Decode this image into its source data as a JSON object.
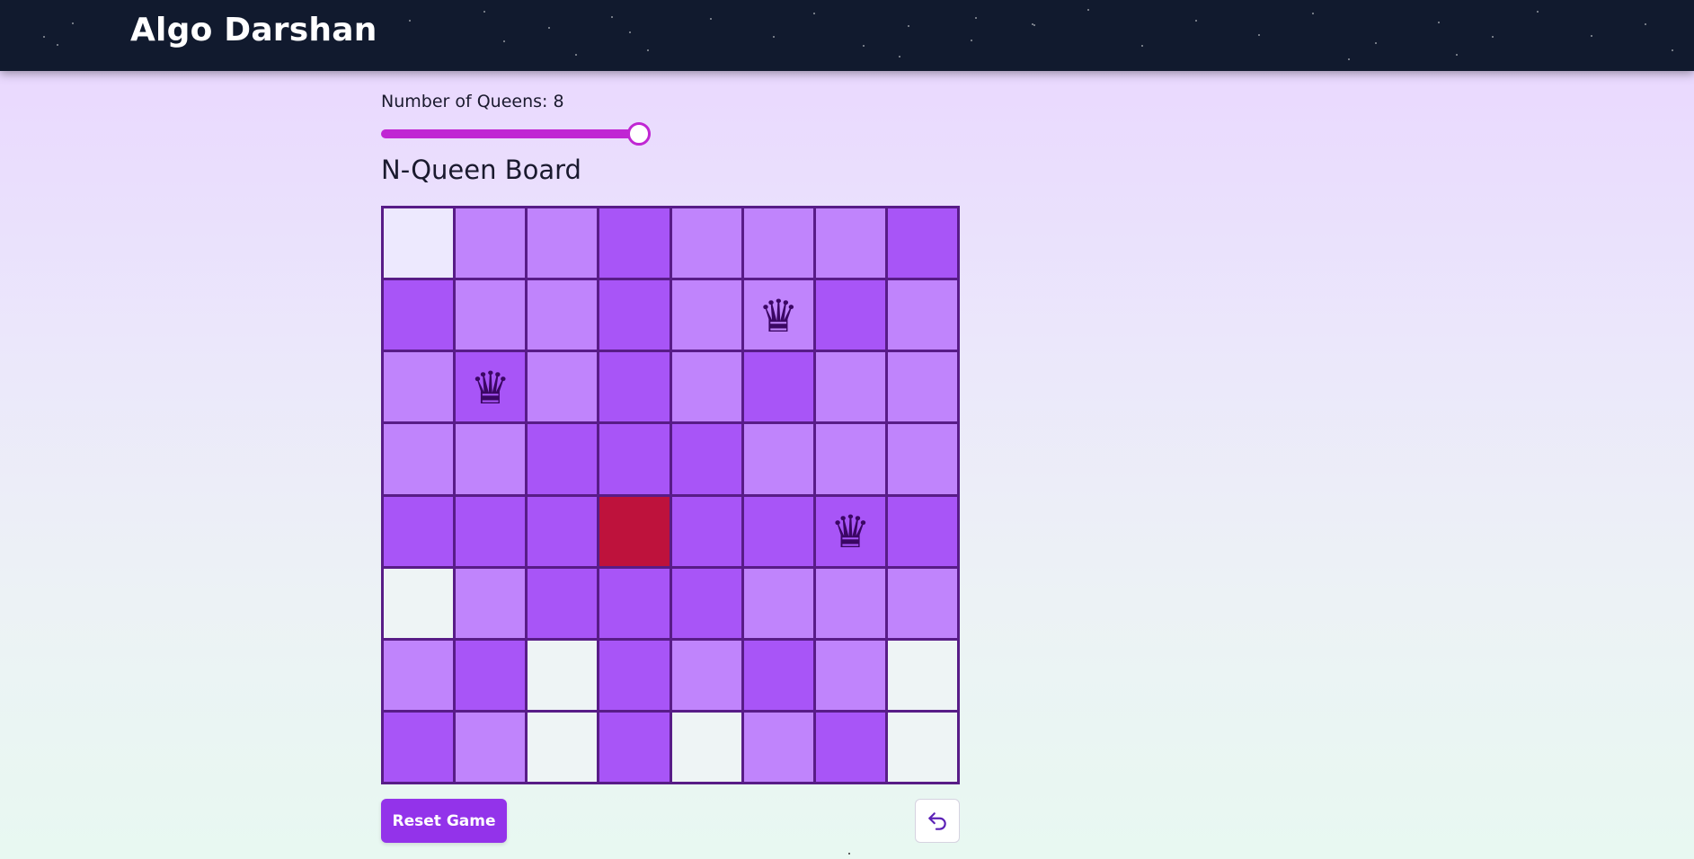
{
  "header": {
    "brand": "Algo Darshan"
  },
  "controls": {
    "queens_label": "Number of Queens: 8",
    "queens_value": 8,
    "slider_min": 4,
    "slider_max": 8,
    "slider_fraction": 1.0
  },
  "board": {
    "title": "N-Queen Board",
    "size": 8,
    "queen_glyph": "♛",
    "state_colors": {
      "empty": "#ede9fe",
      "safe": "#eef4f5",
      "attacked": "#c084fc",
      "attacked_strong": "#a855f7",
      "conflict": "#be123c"
    },
    "cells": [
      [
        "empty",
        "attacked",
        "attacked",
        "attacked_strong",
        "attacked",
        "attacked",
        "attacked",
        "attacked_strong"
      ],
      [
        "attacked_strong",
        "attacked",
        "attacked",
        "attacked_strong",
        "attacked",
        "queen",
        "attacked_strong",
        "attacked"
      ],
      [
        "attacked",
        "queen",
        "attacked",
        "attacked_strong",
        "attacked",
        "attacked_strong",
        "attacked",
        "attacked"
      ],
      [
        "attacked",
        "attacked",
        "attacked_strong",
        "attacked_strong",
        "attacked_strong",
        "attacked",
        "attacked",
        "attacked"
      ],
      [
        "attacked_strong",
        "attacked_strong",
        "attacked_strong",
        "conflict",
        "attacked_strong",
        "attacked_strong",
        "queen",
        "attacked_strong"
      ],
      [
        "safe",
        "attacked",
        "attacked_strong",
        "attacked_strong",
        "attacked_strong",
        "attacked",
        "attacked",
        "attacked"
      ],
      [
        "attacked",
        "attacked_strong",
        "safe",
        "attacked_strong",
        "attacked",
        "attacked_strong",
        "attacked",
        "safe"
      ],
      [
        "attacked_strong",
        "attacked",
        "safe",
        "attacked_strong",
        "safe",
        "attacked",
        "attacked_strong",
        "safe"
      ]
    ],
    "queen_cell_colors": {
      "1-5": "attacked",
      "2-1": "attacked_strong",
      "4-6": "attacked_strong"
    },
    "queens": [
      {
        "row": 1,
        "col": 5
      },
      {
        "row": 2,
        "col": 1
      },
      {
        "row": 4,
        "col": 6
      }
    ]
  },
  "actions": {
    "reset_label": "Reset Game",
    "undo_icon": "undo-icon",
    "accent": "#9333ea"
  }
}
